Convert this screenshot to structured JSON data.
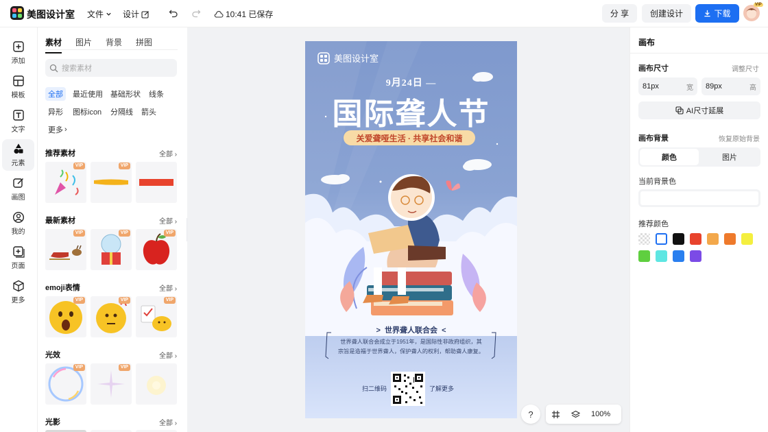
{
  "app": {
    "title": "美图设计室"
  },
  "topbar": {
    "menu_file": "文件",
    "menu_design": "设计",
    "save_status": "10:41 已保存",
    "share_label": "分 享",
    "create_label": "创建设计",
    "download_label": "下载",
    "avatar_badge": "VIP"
  },
  "leftnav": {
    "items": [
      {
        "label": "添加",
        "icon": "plus-square-icon"
      },
      {
        "label": "模板",
        "icon": "template-icon"
      },
      {
        "label": "文字",
        "icon": "text-icon"
      },
      {
        "label": "元素",
        "icon": "shapes-icon"
      },
      {
        "label": "画图",
        "icon": "draw-icon"
      },
      {
        "label": "我的",
        "icon": "user-icon"
      },
      {
        "label": "页面",
        "icon": "page-icon"
      },
      {
        "label": "更多",
        "icon": "cube-icon"
      }
    ]
  },
  "panel": {
    "tabs": [
      "素材",
      "图片",
      "背景",
      "拼图"
    ],
    "search_placeholder": "搜索素材",
    "chips": [
      "全部",
      "最近使用",
      "基础形状",
      "线条",
      "异形",
      "图标icon",
      "分隔线",
      "箭头",
      "更多"
    ],
    "sections": [
      {
        "title": "推荐素材",
        "more": "全部"
      },
      {
        "title": "最新素材",
        "more": "全部"
      },
      {
        "title": "emoji表情",
        "more": "全部"
      },
      {
        "title": "光效",
        "more": "全部"
      },
      {
        "title": "光影",
        "more": "全部"
      }
    ],
    "vip_badge": "VIP"
  },
  "poster": {
    "brand": "美图设计室",
    "date": "9月24日 —",
    "title": "国际聋人节",
    "subtitle": "关爱聋哑生活 · 共享社会和谐",
    "org": "世界聋人联合会",
    "desc_line1": "世界聋人联合会成立于1951年，是国际性非政府组织，其",
    "desc_line2": "宗旨是造福于世界聋人，保护聋人的权利，帮助聋人康复。",
    "scan_left": "扫二维码",
    "scan_right": "了解更多"
  },
  "canvas_tools": {
    "help": "?",
    "zoom": "100%"
  },
  "right_panel": {
    "title": "画布",
    "size_label": "画布尺寸",
    "adjust_size": "调整尺寸",
    "width_value": "81px",
    "width_unit": "宽",
    "height_value": "89px",
    "height_unit": "高",
    "ai_extend": "AI尺寸延展",
    "bg_label": "画布背景",
    "restore_bg": "恢复原始背景",
    "seg_color": "颜色",
    "seg_image": "图片",
    "current_bg": "当前背景色",
    "recommended": "推荐颜色",
    "swatches": [
      "transparent",
      "#ffffff",
      "#111111",
      "#e8432d",
      "#f3a84b",
      "#ee7a2c",
      "#f4ef3f",
      "#5fcf3f",
      "#5ee6e2",
      "#2a7fef",
      "#7b4be6"
    ]
  }
}
